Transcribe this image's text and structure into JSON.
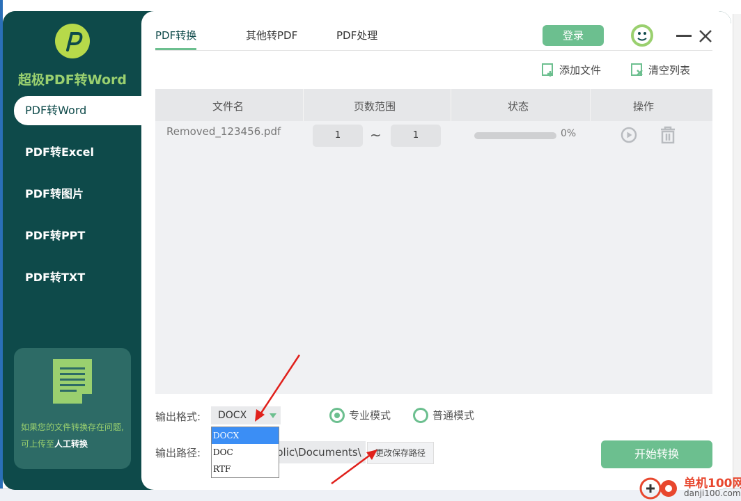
{
  "app": {
    "title": "超极PDF转Word"
  },
  "sidebar": {
    "items": [
      {
        "label": "PDF转Word"
      },
      {
        "label": "PDF转Excel"
      },
      {
        "label": "PDF转图片"
      },
      {
        "label": "PDF转PPT"
      },
      {
        "label": "PDF转TXT"
      }
    ],
    "help_text": "如果您的文件转换存在问题,可上传至",
    "help_link": "人工转换"
  },
  "tabs": [
    {
      "label": "PDF转换"
    },
    {
      "label": "其他转PDF"
    },
    {
      "label": "PDF处理"
    }
  ],
  "header": {
    "login_label": "登录"
  },
  "toolbar": {
    "add_file_label": "添加文件",
    "clear_list_label": "清空列表"
  },
  "table": {
    "headers": [
      "文件名",
      "页数范围",
      "状态",
      "操作"
    ],
    "rows": [
      {
        "file": "Removed_123456.pdf",
        "page_from": "1",
        "page_to": "1",
        "progress": 0,
        "progress_text": "0%"
      }
    ],
    "range_sep": "~"
  },
  "output": {
    "format_label": "输出格式:",
    "format_value": "DOCX",
    "format_options": [
      "DOCX",
      "DOC",
      "RTF"
    ],
    "mode_pro_label": "专业模式",
    "mode_normal_label": "普通模式",
    "path_label": "输出路径:",
    "path_value": "blic\\Documents\\",
    "change_path_label": "更改保存路径",
    "start_label": "开始转换"
  },
  "watermark": {
    "text": "单机100网",
    "url": "danji100.com"
  },
  "colors": {
    "sidebar": "#0e4a4a",
    "accent": "#6cbf8f",
    "logo": "#9ad06f"
  }
}
